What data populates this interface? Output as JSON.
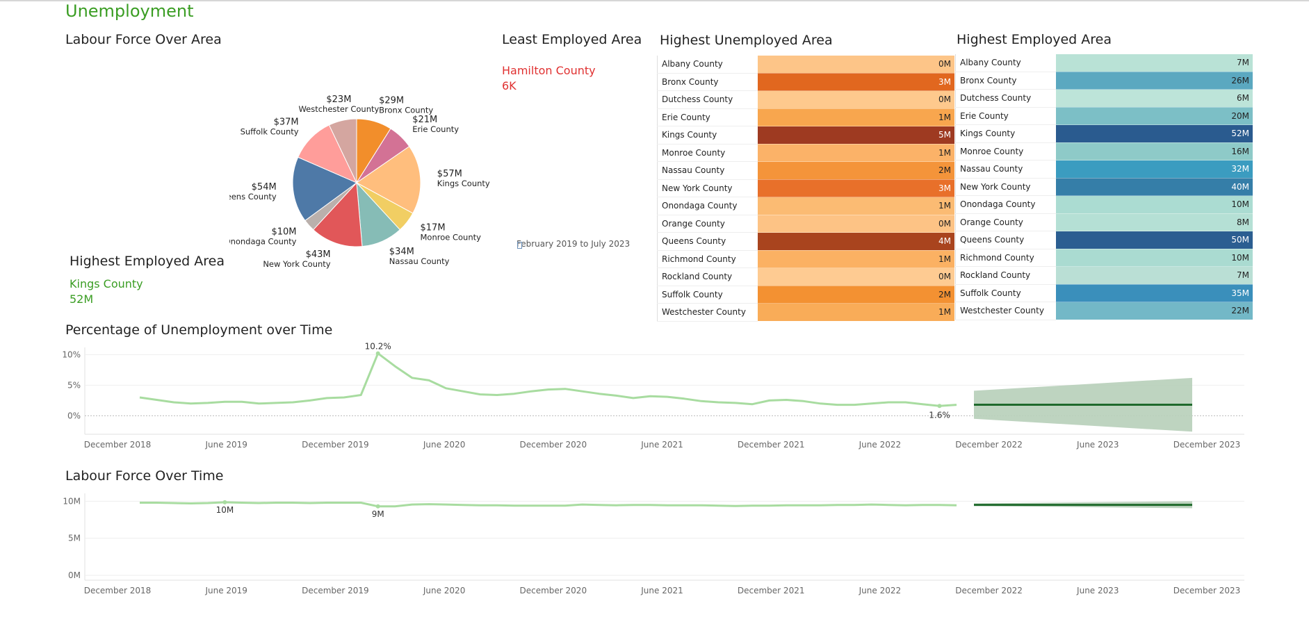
{
  "dashboard": {
    "title": "Unemployment"
  },
  "labour_force_area": {
    "title": "Labour Force Over Area"
  },
  "least_employed": {
    "title": "Least Employed Area",
    "county": "Hamilton County",
    "value": "6K"
  },
  "highest_employed_kpi": {
    "title": "Highest Employed Area",
    "county": "Kings County",
    "value": "52M"
  },
  "date_range": "February 2019 to July 2023",
  "highest_unemployed_table": {
    "title": "Highest Unemployed Area",
    "rows": [
      {
        "county": "Albany County",
        "value": "0M",
        "color": "#fdc588",
        "text": "#222"
      },
      {
        "county": "Bronx County",
        "value": "3M",
        "color": "#e1671f",
        "text": "#fff"
      },
      {
        "county": "Dutchess County",
        "value": "0M",
        "color": "#fec98d",
        "text": "#222"
      },
      {
        "county": "Erie County",
        "value": "1M",
        "color": "#f8a64e",
        "text": "#222"
      },
      {
        "county": "Kings County",
        "value": "5M",
        "color": "#9e3a21",
        "text": "#fff"
      },
      {
        "county": "Monroe County",
        "value": "1M",
        "color": "#fbb268",
        "text": "#222"
      },
      {
        "county": "Nassau County",
        "value": "2M",
        "color": "#f4943a",
        "text": "#222"
      },
      {
        "county": "New York County",
        "value": "3M",
        "color": "#e8702a",
        "text": "#fff"
      },
      {
        "county": "Onondaga County",
        "value": "1M",
        "color": "#fbbb73",
        "text": "#222"
      },
      {
        "county": "Orange County",
        "value": "0M",
        "color": "#fdc385",
        "text": "#222"
      },
      {
        "county": "Queens County",
        "value": "4M",
        "color": "#a9441e",
        "text": "#fff"
      },
      {
        "county": "Richmond County",
        "value": "1M",
        "color": "#fbb163",
        "text": "#222"
      },
      {
        "county": "Rockland County",
        "value": "0M",
        "color": "#fecb92",
        "text": "#222"
      },
      {
        "county": "Suffolk County",
        "value": "2M",
        "color": "#f39132",
        "text": "#222"
      },
      {
        "county": "Westchester County",
        "value": "1M",
        "color": "#f9ac58",
        "text": "#222"
      }
    ]
  },
  "highest_employed_table": {
    "title": "Highest Employed Area",
    "rows": [
      {
        "county": "Albany County",
        "value": "7M",
        "color": "#b9e2d6",
        "text": "#222"
      },
      {
        "county": "Bronx County",
        "value": "26M",
        "color": "#5ba8c0",
        "text": "#222"
      },
      {
        "county": "Dutchess County",
        "value": "6M",
        "color": "#bde4d9",
        "text": "#222"
      },
      {
        "county": "Erie County",
        "value": "20M",
        "color": "#7cbfc6",
        "text": "#222"
      },
      {
        "county": "Kings County",
        "value": "52M",
        "color": "#2a5b8f",
        "text": "#fff"
      },
      {
        "county": "Monroe County",
        "value": "16M",
        "color": "#8ecac8",
        "text": "#222"
      },
      {
        "county": "Nassau County",
        "value": "32M",
        "color": "#3b9cc0",
        "text": "#fff"
      },
      {
        "county": "New York County",
        "value": "40M",
        "color": "#357ea8",
        "text": "#fff"
      },
      {
        "county": "Onondaga County",
        "value": "10M",
        "color": "#abdcd2",
        "text": "#222"
      },
      {
        "county": "Orange County",
        "value": "8M",
        "color": "#b5e0d5",
        "text": "#222"
      },
      {
        "county": "Queens County",
        "value": "50M",
        "color": "#2b5e91",
        "text": "#fff"
      },
      {
        "county": "Richmond County",
        "value": "10M",
        "color": "#aadbd1",
        "text": "#222"
      },
      {
        "county": "Rockland County",
        "value": "7M",
        "color": "#badfd5",
        "text": "#222"
      },
      {
        "county": "Suffolk County",
        "value": "35M",
        "color": "#3a8fbb",
        "text": "#fff"
      },
      {
        "county": "Westchester County",
        "value": "22M",
        "color": "#73b8c7",
        "text": "#222"
      }
    ]
  },
  "unemployment_time": {
    "title": "Percentage of Unemployment over Time",
    "peak_label": "10.2%",
    "last_label": "1.6%"
  },
  "labour_time": {
    "title": "Labour Force Over Time",
    "label_a": "10M",
    "label_b": "9M"
  },
  "chart_data": [
    {
      "type": "pie",
      "title": "Labour Force Over Area",
      "slices": [
        {
          "label": "Bronx County",
          "value_label": "$29M",
          "value": 29,
          "color": "#f28e2b"
        },
        {
          "label": "Erie County",
          "value_label": "$21M",
          "value": 21,
          "color": "#d37295"
        },
        {
          "label": "Kings County",
          "value_label": "$57M",
          "value": 57,
          "color": "#ffbe7d"
        },
        {
          "label": "Monroe County",
          "value_label": "$17M",
          "value": 17,
          "color": "#f1ce63"
        },
        {
          "label": "Nassau County",
          "value_label": "$34M",
          "value": 34,
          "color": "#86bcb6"
        },
        {
          "label": "New York County",
          "value_label": "$43M",
          "value": 43,
          "color": "#e15759"
        },
        {
          "label": "Onondaga County",
          "value_label": "$10M",
          "value": 10,
          "color": "#bab0ac"
        },
        {
          "label": "Queens County",
          "value_label": "$54M",
          "value": 54,
          "color": "#4e79a7"
        },
        {
          "label": "Suffolk County",
          "value_label": "$37M",
          "value": 37,
          "color": "#ff9d9a"
        },
        {
          "label": "Westchester County",
          "value_label": "$23M",
          "value": 23,
          "color": "#d4a6a0"
        }
      ]
    },
    {
      "type": "line",
      "title": "Percentage of Unemployment over Time",
      "x_ticks": [
        "December 2018",
        "June 2019",
        "December 2019",
        "June 2020",
        "December 2020",
        "June 2021",
        "December 2021",
        "June 2022",
        "December 2022",
        "June 2023",
        "December 2023"
      ],
      "y_ticks": [
        "10%",
        "5%",
        "0%"
      ],
      "ylim": [
        -2,
        10.5
      ],
      "series": [
        {
          "values": [
            3.0,
            2.6,
            2.2,
            2.0,
            2.1,
            2.3,
            2.3,
            2.0,
            2.1,
            2.2,
            2.5,
            2.9,
            3.0,
            3.4,
            10.2,
            8.1,
            6.2,
            5.8,
            4.5,
            4.0,
            3.5,
            3.4,
            3.6,
            4.0,
            4.3,
            4.4,
            4.0,
            3.6,
            3.3,
            2.9,
            3.2,
            3.1,
            2.8,
            2.4,
            2.2,
            2.1,
            1.9,
            2.5,
            2.6,
            2.4,
            2.0,
            1.8,
            1.8,
            2.0,
            2.2,
            2.2,
            1.9,
            1.6,
            1.8
          ]
        }
      ],
      "forecast": {
        "value": 1.8,
        "upper_start": 4.1,
        "upper_end": 6.2,
        "lower_start": -0.5,
        "lower_end": -2.6
      }
    },
    {
      "type": "line",
      "title": "Labour Force Over Time",
      "x_ticks": [
        "December 2018",
        "June 2019",
        "December 2019",
        "June 2020",
        "December 2020",
        "June 2021",
        "December 2021",
        "June 2022",
        "December 2022",
        "June 2023",
        "December 2023"
      ],
      "y_ticks": [
        "10M",
        "5M",
        "0M"
      ],
      "ylim": [
        0,
        10.5
      ],
      "series": [
        {
          "values": [
            9.8,
            9.8,
            9.75,
            9.7,
            9.75,
            9.85,
            9.8,
            9.75,
            9.8,
            9.8,
            9.75,
            9.8,
            9.8,
            9.8,
            9.3,
            9.3,
            9.55,
            9.6,
            9.55,
            9.5,
            9.45,
            9.45,
            9.4,
            9.4,
            9.4,
            9.4,
            9.55,
            9.5,
            9.45,
            9.5,
            9.5,
            9.45,
            9.45,
            9.45,
            9.4,
            9.35,
            9.4,
            9.4,
            9.45,
            9.45,
            9.45,
            9.5,
            9.5,
            9.55,
            9.5,
            9.45,
            9.5,
            9.5,
            9.45
          ]
        }
      ],
      "forecast": {
        "value": 9.5,
        "upper_start": 9.7,
        "upper_end": 10.0,
        "lower_start": 9.35,
        "lower_end": 9.05
      }
    }
  ]
}
